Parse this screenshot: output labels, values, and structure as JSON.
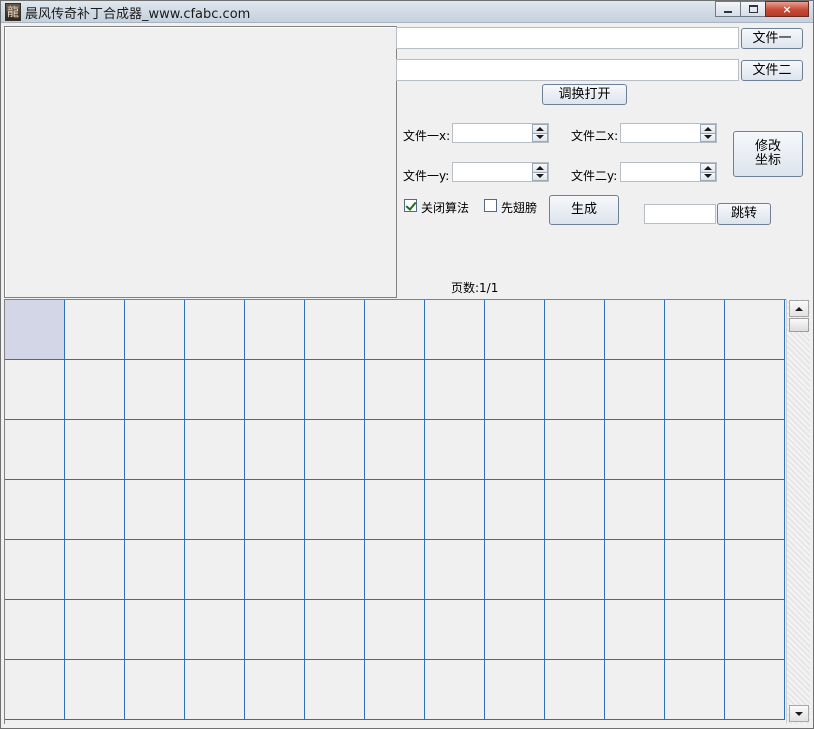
{
  "window": {
    "title": "晨风传奇补丁合成器_www.cfabc.com",
    "icon_glyph": "龍",
    "controls": {
      "minimize": "minimize-icon",
      "maximize": "maximize-icon",
      "close": "×"
    }
  },
  "files": {
    "file1_value": "",
    "file1_button": "文件一",
    "file2_value": "",
    "file2_button": "文件二",
    "swap_button": "调换打开"
  },
  "coords": {
    "file1_x_label": "文件一x:",
    "file1_x_value": "",
    "file2_x_label": "文件二x:",
    "file2_x_value": "",
    "file1_y_label": "文件一y:",
    "file1_y_value": "",
    "file2_y_label": "文件二y:",
    "file2_y_value": "",
    "modify_button_line1": "修改",
    "modify_button_line2": "坐标"
  },
  "options": {
    "close_algorithm_label": "关闭算法",
    "close_algorithm_checked": true,
    "wing_first_label": "先翅膀",
    "wing_first_checked": false,
    "generate_button": "生成",
    "jump_value": "",
    "jump_button": "跳转"
  },
  "pagination": {
    "label": "页数:1/1"
  },
  "grid": {
    "columns": 13,
    "rows": 7,
    "selected_index": 0,
    "line_color": "#2f6fb8",
    "selected_color": "#d3d6e6"
  }
}
